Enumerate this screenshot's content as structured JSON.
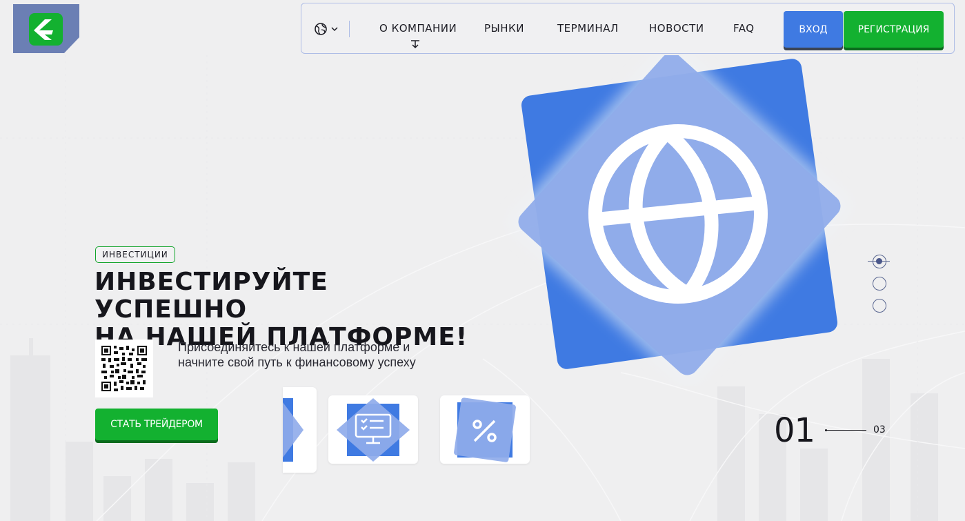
{
  "brand": {
    "logo_icon": "k-arrow-logo",
    "colors": {
      "accent_blue": "#3f7ae2",
      "accent_green": "#13b130",
      "logo_bg": "#6b7fb4"
    }
  },
  "nav": {
    "language_icon": "globe-icon",
    "items": [
      {
        "label": "О КОМПАНИИ"
      },
      {
        "label": "РЫНКИ"
      },
      {
        "label": "ТЕРМИНАЛ"
      },
      {
        "label": "НОВОСТИ"
      },
      {
        "label": "FAQ"
      }
    ],
    "login_label": "ВХОД",
    "register_label": "РЕГИСТРАЦИЯ"
  },
  "hero": {
    "tag": "ИНВЕСТИЦИИ",
    "headline_line1": "ИНВЕСТИРУЙТЕ УСПЕШНО",
    "headline_line2": "НА НАШЕЙ ПЛАТФОРМЕ!",
    "subtitle_line1": "Присоединяйтесь к нашей платформе и",
    "subtitle_line2": "начните свой путь к финансовому успеху",
    "cta_label": "СТАТЬ ТРЕЙДЕРОМ",
    "graphic_icon": "globe-icon"
  },
  "cards": [
    {
      "icon": "partial-card-icon"
    },
    {
      "icon": "monitor-checklist-icon"
    },
    {
      "icon": "percent-icon"
    }
  ],
  "slider": {
    "dots": 3,
    "active_index": 0,
    "current": "01",
    "total": "03"
  }
}
